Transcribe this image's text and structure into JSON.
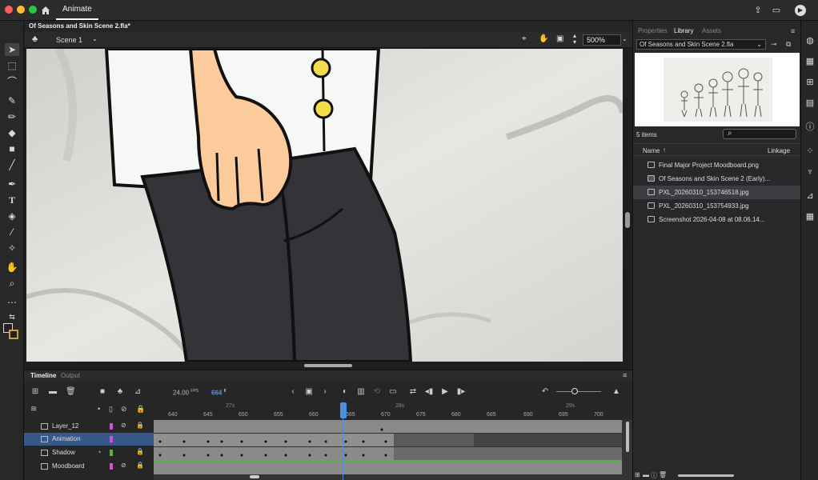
{
  "app": {
    "tab_label": "Animate",
    "document_title": "Of Seasons and Skin Scene 2.fla*"
  },
  "stage_bar": {
    "scene_label": "Scene 1",
    "zoom": "500%"
  },
  "timeline": {
    "tabs": [
      "Timeline",
      "Output"
    ],
    "fps_value": "24.00",
    "fps_unit": "FPS",
    "current_frame": "664",
    "frame_suffix": "F",
    "seconds_labels": [
      "27s",
      "28s",
      "29s"
    ],
    "frame_ticks": [
      "640",
      "645",
      "650",
      "655",
      "660",
      "665",
      "670",
      "675",
      "680",
      "685",
      "690",
      "695",
      "700"
    ],
    "layers": [
      {
        "name": "Layer_12",
        "color": "#d84fd8",
        "selected": false
      },
      {
        "name": "Animation",
        "color": "#d84fd8",
        "selected": true
      },
      {
        "name": "Shadow",
        "color": "#5ab04a",
        "selected": false
      },
      {
        "name": "Moodboard",
        "color": "#d84fd8",
        "selected": false
      }
    ]
  },
  "right_panel": {
    "tabs": [
      "Properties",
      "Library",
      "Assets"
    ],
    "active_tab": "Library",
    "library_file": "Of Seasons and Skin Scene 2.fla",
    "items_count": "5 items",
    "col_name": "Name",
    "col_linkage": "Linkage",
    "items": [
      {
        "name": "Final Major Project Moodboard.png",
        "selected": false
      },
      {
        "name": "Of Seasons and Skin Scene 2 (Early)...",
        "selected": false
      },
      {
        "name": "PXL_20260310_153746518.jpg",
        "selected": true
      },
      {
        "name": "PXL_20260310_153754933.jpg",
        "selected": false
      },
      {
        "name": "Screenshot 2026-04-08 at 08.06.14...",
        "selected": false
      }
    ]
  },
  "colors": {
    "accent_blue": "#4a9df0",
    "selected_layer": "#37598a",
    "button_yellow": "#f5dd4a",
    "skin": "#fccb9c",
    "pants": "#333338"
  }
}
